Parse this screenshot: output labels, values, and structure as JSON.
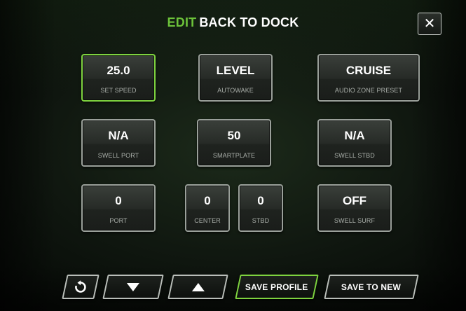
{
  "header": {
    "edit_label": "EDIT",
    "title": "BACK TO DOCK",
    "close_icon": "close-icon"
  },
  "tiles": {
    "set_speed": {
      "value": "25.0",
      "label": "SET SPEED",
      "active": true
    },
    "autowake": {
      "value": "LEVEL",
      "label": "AUTOWAKE"
    },
    "audio_zone_preset": {
      "value": "CRUISE",
      "label": "AUDIO ZONE PRESET"
    },
    "swell_port": {
      "value": "N/A",
      "label": "SWELL PORT"
    },
    "smartplate": {
      "value": "50",
      "label": "SMARTPLATE"
    },
    "swell_stbd": {
      "value": "N/A",
      "label": "SWELL STBD"
    },
    "port": {
      "value": "0",
      "label": "PORT"
    },
    "center": {
      "value": "0",
      "label": "CENTER"
    },
    "stbd": {
      "value": "0",
      "label": "STBD"
    },
    "swell_surf": {
      "value": "OFF",
      "label": "SWELL SURF"
    }
  },
  "toolbar": {
    "reset_icon": "reset-icon",
    "down_icon": "arrow-down-icon",
    "up_icon": "arrow-up-icon",
    "save_profile_label": "SAVE PROFILE",
    "save_to_new_label": "SAVE TO NEW"
  },
  "colors": {
    "accent": "#7ed33f",
    "edit_text": "#6cc23a",
    "background": "#0f160f",
    "tile_border": "#9aa09a"
  }
}
